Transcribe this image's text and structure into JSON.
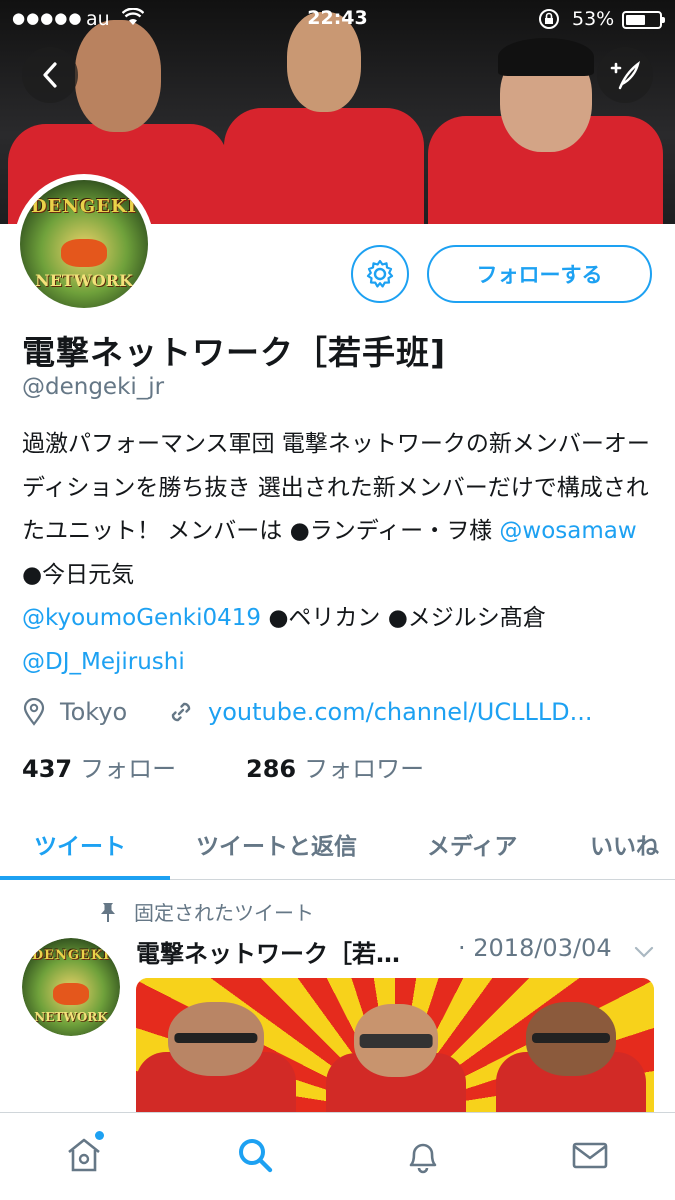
{
  "status_bar": {
    "carrier": "au",
    "time": "22:43",
    "battery": "53%"
  },
  "profile": {
    "name": "電撃ネットワーク［若手班]",
    "handle": "@dengeki_jr",
    "follow_label": "フォローする",
    "avatar_text_top": "DENGEKI",
    "avatar_text_bottom": "NETWORK",
    "bio": {
      "p1": "過激パフォーマンス軍団 電撃ネットワークの新メンバーオーディションを勝ち抜き 選出された新メンバーだけで構成されたユニット！ メンバーは ●ランディー・ヲ様 ",
      "m1": "@wosamaw",
      "p2": " ●今日元気 ",
      "m2": "@kyoumoGenki0419",
      "p3": " ●ペリカン ●メジルシ髙倉 ",
      "m3": "@DJ_Mejirushi"
    },
    "location": "Tokyo",
    "url": "youtube.com/channel/UCLLLD...",
    "following_count": "437",
    "following_label": "フォロー",
    "followers_count": "286",
    "followers_label": "フォロワー"
  },
  "tabs": [
    "ツイート",
    "ツイートと返信",
    "メディア",
    "いいね"
  ],
  "pinned_tweet": {
    "label": "固定されたツイート",
    "author": "電撃ネットワーク［若…",
    "date": "· 2018/03/04"
  },
  "icons": {
    "back": "chevron-left-icon",
    "compose": "compose-icon",
    "settings": "gear-icon",
    "location": "location-pin-icon",
    "link": "link-icon",
    "pin": "pin-icon",
    "home": "home-icon",
    "search": "search-icon",
    "notifications": "bell-icon",
    "messages": "mail-icon"
  },
  "colors": {
    "accent": "#1da1f2",
    "secondary_text": "#657786"
  }
}
